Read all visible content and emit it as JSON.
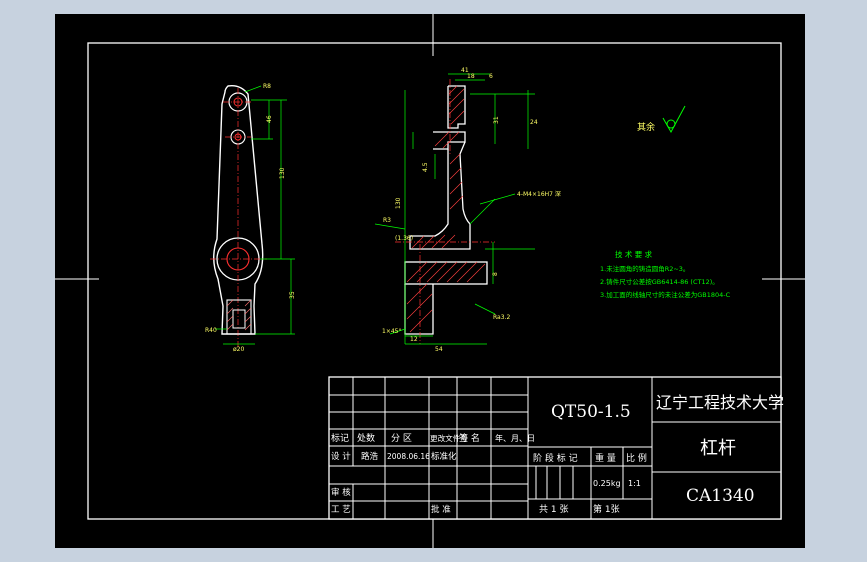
{
  "title_block": {
    "material": "QT50-1.5",
    "school": "辽宁工程技术大学",
    "part_name": "杠杆",
    "drawing_no": "CA1340",
    "revision_headers": [
      "标记",
      "处数",
      "分 区",
      "更改文件号",
      "签 名",
      "年、月、日"
    ],
    "design_label": "设 计",
    "designer": "路浩",
    "design_date": "2008.06.16",
    "standardization": "标准化",
    "review": "审 核",
    "process": "工 艺",
    "approve": "批 准",
    "stage_mark": "阶 段 标 记",
    "weight_label": "重 量",
    "scale_label": "比 例",
    "weight": "0.25kg",
    "scale": "1:1",
    "sheets_total": "共 1 张",
    "sheet_no": "第 1张"
  },
  "drawing": {
    "surface_finish_label": "其余",
    "tech_req_title": "技 术 要 求",
    "tech_req": [
      "1.未注圆角的铸造圆角R2~3。",
      "2.铸件尺寸公差按GB6414-86 (CT12)。",
      "3.加工面的线轴尺寸的未注公差为GB1804-C"
    ]
  }
}
